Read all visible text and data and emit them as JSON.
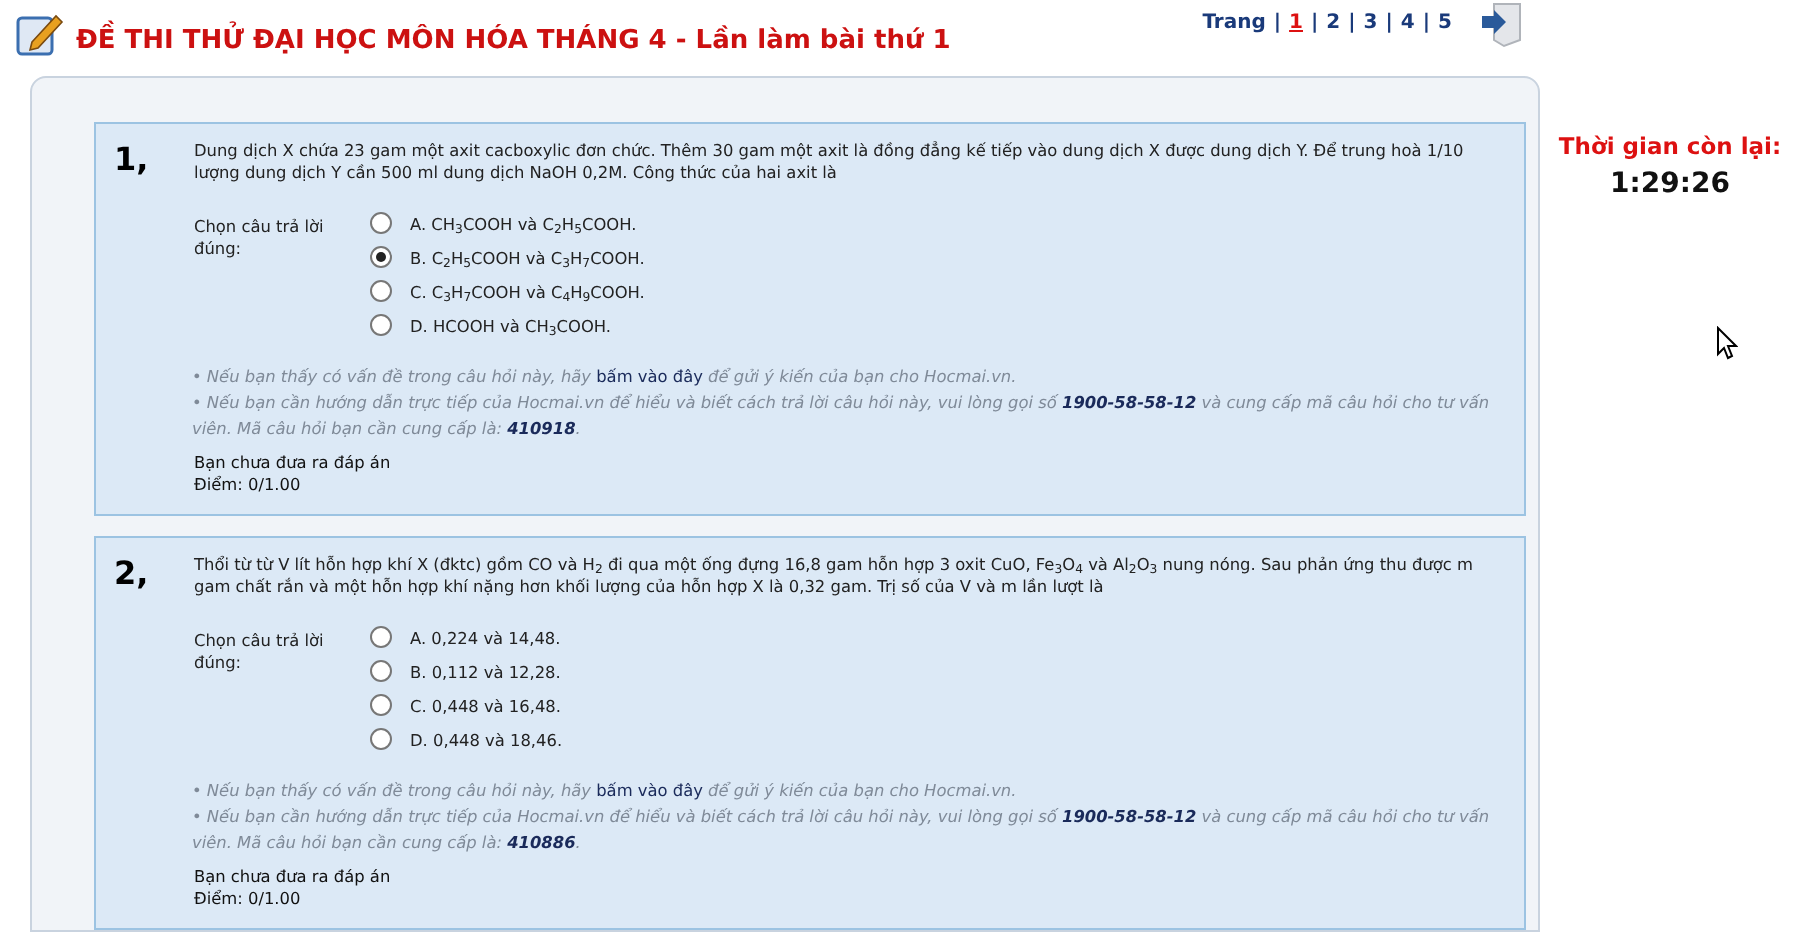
{
  "header": {
    "title": "ĐỀ THI THỬ ĐẠI HỌC MÔN HÓA THÁNG 4 - Lần làm bài thứ 1"
  },
  "pagination": {
    "label": "Trang",
    "separator": "|",
    "pages": [
      {
        "label": "1",
        "selected": true
      },
      {
        "label": "2",
        "selected": false
      },
      {
        "label": "3",
        "selected": false
      },
      {
        "label": "4",
        "selected": false
      },
      {
        "label": "5",
        "selected": false
      }
    ]
  },
  "timer": {
    "label": "Thời gian còn lại:",
    "value": "1:29:26"
  },
  "questions": [
    {
      "number": "1,",
      "text": "Dung dịch X chứa 23 gam một axit cacboxylic đơn chức. Thêm 30 gam một axit là đồng đẳng kế tiếp vào dung dịch X được dung dịch Y. Để trung hoà 1/10 lượng dung dịch Y cần 500 ml dung dịch NaOH 0,2M. Công thức của hai axit là",
      "prompt": "Chọn câu trả lời đúng:",
      "options": [
        {
          "label": "A. CH$_{3}$COOH và C$_{2}$H$_{5}$COOH.",
          "selected": false
        },
        {
          "label": "B. C$_{2}$H$_{5}$COOH và C$_{3}$H$_{7}$COOH.",
          "selected": true
        },
        {
          "label": "C. C$_{3}$H$_{7}$COOH và C$_{4}$H$_{9}$COOH.",
          "selected": false
        },
        {
          "label": "D. HCOOH và CH$_{3}$COOH.",
          "selected": false
        }
      ],
      "report_hint": {
        "before": "• Nếu bạn thấy có vấn đề trong câu hỏi này, hãy ",
        "link": "bấm vào đây",
        "after": " để gửi ý kiến của bạn cho Hocmai.vn."
      },
      "support_hint": "• Nếu bạn cần hướng dẫn trực tiếp của Hocmai.vn để hiểu và biết cách trả lời câu hỏi này, vui lòng gọi số **1900-58-58-12** và cung cấp mã câu hỏi cho tư vấn viên. Mã câu hỏi bạn cần cung cấp là: **410918**.",
      "status": "Bạn chưa đưa ra đáp án",
      "score": "Điểm: 0/1.00"
    },
    {
      "number": "2,",
      "text": "Thổi từ từ V lít hỗn hợp khí X (đktc) gồm CO và H$_{2}$ đi qua một ống đựng 16,8 gam hỗn hợp 3 oxit CuO, Fe$_{3}$O$_{4}$ và Al$_{2}$O$_{3}$ nung nóng. Sau phản ứng thu được m gam chất rắn và một hỗn hợp khí nặng hơn khối lượng của hỗn hợp X là 0,32 gam. Trị số của V và m lần lượt là",
      "prompt": "Chọn câu trả lời đúng:",
      "options": [
        {
          "label": "A. 0,224 và 14,48.",
          "selected": false
        },
        {
          "label": "B. 0,112 và 12,28.",
          "selected": false
        },
        {
          "label": "C. 0,448 và 16,48.",
          "selected": false
        },
        {
          "label": "D. 0,448 và 18,46.",
          "selected": false
        }
      ],
      "report_hint": {
        "before": "• Nếu bạn thấy có vấn đề trong câu hỏi này, hãy ",
        "link": "bấm vào đây",
        "after": " để gửi ý kiến của bạn cho Hocmai.vn."
      },
      "support_hint": "• Nếu bạn cần hướng dẫn trực tiếp của Hocmai.vn để hiểu và biết cách trả lời câu hỏi này, vui lòng gọi số **1900-58-58-12** và cung cấp mã câu hỏi cho tư vấn viên. Mã câu hỏi bạn cần cung cấp là: **410886**.",
      "status": "Bạn chưa đưa ra đáp án",
      "score": "Điểm: 0/1.00"
    }
  ]
}
